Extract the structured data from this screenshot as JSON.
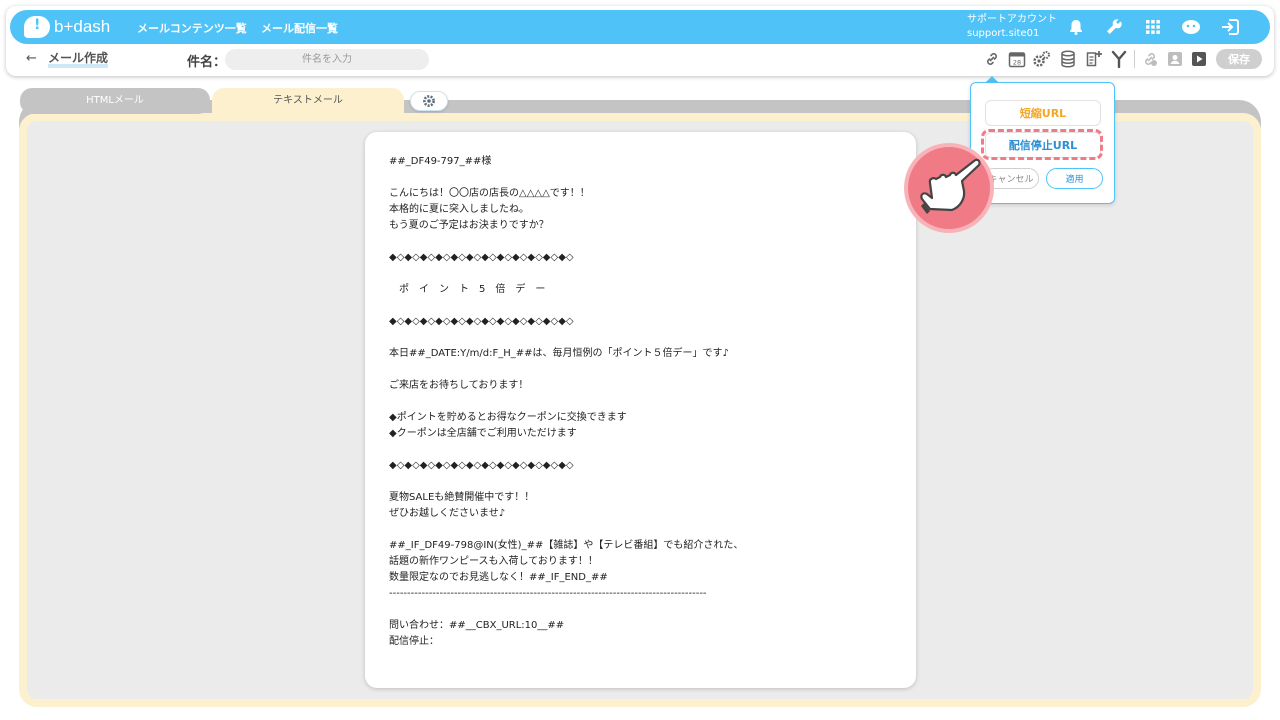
{
  "header": {
    "logo_text": "b+dash",
    "nav": [
      "メールコンテンツ一覧",
      "メール配信一覧"
    ],
    "account_name": "サポートアカウント",
    "account_id": "support.site01",
    "icons": [
      "bell-icon",
      "wrench-icon",
      "grid-icon",
      "support-icon",
      "logout-icon"
    ]
  },
  "toolbar": {
    "back_symbol": "←",
    "breadcrumb": "メール作成",
    "subject_label": "件名：",
    "subject_placeholder": "件名を入力",
    "subject_value": "",
    "icons": [
      "link-icon",
      "calendar-icon",
      "gears-icon",
      "database-icon",
      "add-document-icon",
      "filter-icon",
      "link-off-icon",
      "person-icon",
      "play-icon"
    ],
    "calendar_day": "28",
    "save_label": "保存"
  },
  "tabs": {
    "html_mail": "HTMLメール",
    "text_mail": "テキストメール",
    "settings_icon": "gear-icon"
  },
  "editor": {
    "lines": [
      "##_DF49-797_##様",
      "",
      "こんにちは！〇〇店の店長の△△△△です！！",
      "本格的に夏に突入しましたね。",
      "もう夏のご予定はお決まりですか？",
      "",
      "◆◇◆◇◆◇◆◇◆◇◆◇◆◇◆◇◆◇◆◇◆◇◆◇",
      "",
      "　ポ　イ　ン　ト　5　倍　デ　ー",
      "",
      "◆◇◆◇◆◇◆◇◆◇◆◇◆◇◆◇◆◇◆◇◆◇◆◇",
      "",
      "本日##_DATE:Y/m/d:F_H_##は、毎月恒例の「ポイント５倍デー」です♪",
      "",
      "ご来店をお待ちしております！",
      "",
      "◆ポイントを貯めるとお得なクーポンに交換できます",
      "◆クーポンは全店舗でご利用いただけます",
      "",
      "◆◇◆◇◆◇◆◇◆◇◆◇◆◇◆◇◆◇◆◇◆◇◆◇",
      "",
      "夏物SALEも絶賛開催中です！！",
      "ぜひお越しくださいませ♪",
      "",
      "##_IF_DF49-798@IN(女性)_##【雑誌】や【テレビ番組】でも紹介された、",
      "話題の新作ワンピースも入荷しております！！",
      "数量限定なのでお見逃しなく！##_IF_END_##",
      "----------------------------------------------------------------------------------------",
      "",
      "問い合わせ：##__CBX_URL:10__##",
      "配信停止："
    ]
  },
  "url_popup": {
    "short_url_label": "短縮URL",
    "unsubscribe_url_label": "配信停止URL",
    "cancel_label": "キャンセル",
    "apply_label": "適用"
  },
  "colors": {
    "brand": "#4fc3f7",
    "tab_active": "#fdf0cf",
    "highlight": "#f07a85",
    "short_url": "#f5a623"
  }
}
